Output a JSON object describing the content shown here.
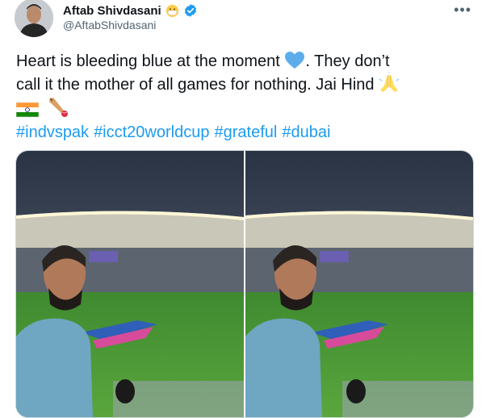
{
  "author": {
    "name": "Aftab Shivdasani",
    "handle": "@AftabShivdasani",
    "verified": true,
    "verified_color": "#1d9bf0"
  },
  "tweet": {
    "line1_a": "Heart is bleeding blue at the moment ",
    "line1_b": ". They don’t",
    "line2": "call it the mother of all games for nothing. Jai Hind ",
    "hashtags": [
      "#indvspak",
      "#icct20worldcup",
      "#grateful",
      "#dubai"
    ],
    "hashtag_color": "#1d9bf0"
  },
  "icons": [
    "more-icon",
    "verified-badge-icon",
    "face-with-mask-emoji",
    "blue-heart-emoji",
    "folded-hands-emoji",
    "india-flag-emoji",
    "cricket-bat-emoji"
  ],
  "media": {
    "photo_count": 2
  }
}
